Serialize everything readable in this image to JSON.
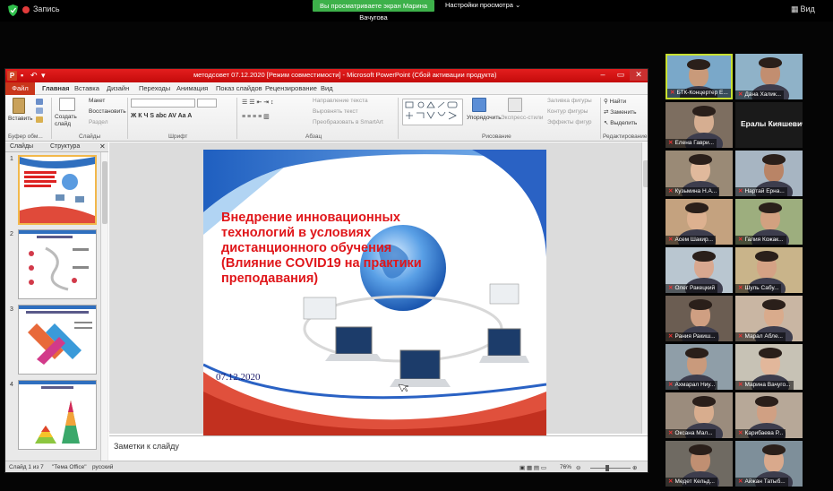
{
  "zoom_top": {
    "recording_label": "Запись",
    "share_banner": "Вы просматриваете экран Марина Вачугова",
    "view_options": "Настройки просмотра",
    "view_button": "Вид"
  },
  "ppt": {
    "window_title": "методсовет 07.12.2020  [Режим совместимости]  -  Microsoft PowerPoint (Сбой активации продукта)",
    "menu": [
      "Файл",
      "Главная",
      "Вставка",
      "Дизайн",
      "Переходы",
      "Анимация",
      "Показ слайдов",
      "Рецензирование",
      "Вид"
    ],
    "ribbon": {
      "paste": "Вставить",
      "create_slide": "Создать слайд",
      "layout": "Макет",
      "reset": "Восстановить",
      "section": "Раздел",
      "text_direction": "Направление текста",
      "align_text": "Выровнять текст",
      "convert_smartart": "Преобразовать в SmartArt",
      "arrange": "Упорядочить",
      "quick_styles": "Экспресс-стили",
      "shape_fill": "Заливка фигуры",
      "shape_outline": "Контур фигуры",
      "shape_effects": "Эффекты фигур",
      "find": "Найти",
      "replace": "Заменить",
      "select": "Выделить",
      "groups": {
        "clipboard": "Буфер обм...",
        "slides": "Слайды",
        "font": "Шрифт",
        "paragraph": "Абзац",
        "drawing": "Рисование",
        "editing": "Редактирование"
      }
    },
    "pane_tabs": [
      "Слайды",
      "Структура"
    ],
    "thumb_numbers": [
      "1",
      "2",
      "3",
      "4"
    ],
    "slide": {
      "title": "Внедрение инновационных технологий в условиях дистанционного обучения (Влияние COVID19 на практики преподавания)",
      "date": "07.12.2020"
    },
    "notes_placeholder": "Заметки к слайду",
    "status": {
      "slide_counter": "Слайд 1 из 7",
      "theme": "\"Тема Office\"",
      "language": "русский",
      "zoom": "76%"
    }
  },
  "participants": [
    {
      "name": "БТК-Концертер Е...",
      "speaker": true,
      "bg": "#7aa8c9",
      "skin": "#c99a7a"
    },
    {
      "name": "Дана Халик...",
      "speaker": false,
      "bg": "#8fb2c8",
      "skin": "#c28e70"
    },
    {
      "name": "Елена Гаври...",
      "speaker": false,
      "bg": "#7d6e60",
      "skin": "#d6ae91"
    },
    {
      "name": "Ералы Кияшевич",
      "speaker": false,
      "name_only": true
    },
    {
      "name": "Кузьмина Н.А...",
      "speaker": false,
      "bg": "#9a8a76",
      "skin": "#e0b99c"
    },
    {
      "name": "Нартай Ерна...",
      "speaker": false,
      "bg": "#a7b5c2",
      "skin": "#b98466"
    },
    {
      "name": "Асем Шакир...",
      "speaker": false,
      "bg": "#c4a27f",
      "skin": "#ddb190"
    },
    {
      "name": "Галия Кожак...",
      "speaker": false,
      "bg": "#9dae7e",
      "skin": "#d2a180"
    },
    {
      "name": "Олег Ракецкий",
      "speaker": false,
      "bg": "#b9c6d0",
      "skin": "#d8a890"
    },
    {
      "name": "Шуль Сабу...",
      "speaker": false,
      "bg": "#c9b48a",
      "skin": "#d4a285"
    },
    {
      "name": "Рания Ракиш...",
      "speaker": false,
      "bg": "#6b5d52",
      "skin": "#cf9f82"
    },
    {
      "name": "Марал Абле...",
      "speaker": false,
      "bg": "#c9b6a3",
      "skin": "#d9ab8c"
    },
    {
      "name": "Ахмарал Ниу...",
      "speaker": false,
      "bg": "#8f9ea8",
      "skin": "#c99a7c"
    },
    {
      "name": "Марина Вачуго...",
      "speaker": false,
      "bg": "#c7c2b5",
      "skin": "#e2b79b"
    },
    {
      "name": "Оксана Мал...",
      "speaker": false,
      "bg": "#9b8c7d",
      "skin": "#d8ad8e"
    },
    {
      "name": "Карибаева Р...",
      "speaker": false,
      "bg": "#b7a898",
      "skin": "#d0a083"
    },
    {
      "name": "Медет Кельд...",
      "speaker": false,
      "bg": "#6f6a62",
      "skin": "#c08f72"
    },
    {
      "name": "Айжан Татыб...",
      "speaker": false,
      "bg": "#7e8f9a",
      "skin": "#d9a98c"
    }
  ],
  "colors": {
    "ppt_red": "#d91616",
    "file_tab": "#c9361b",
    "slide_title": "#e0161a",
    "share_green": "#3db14a",
    "speaker_border": "#c8e030"
  }
}
